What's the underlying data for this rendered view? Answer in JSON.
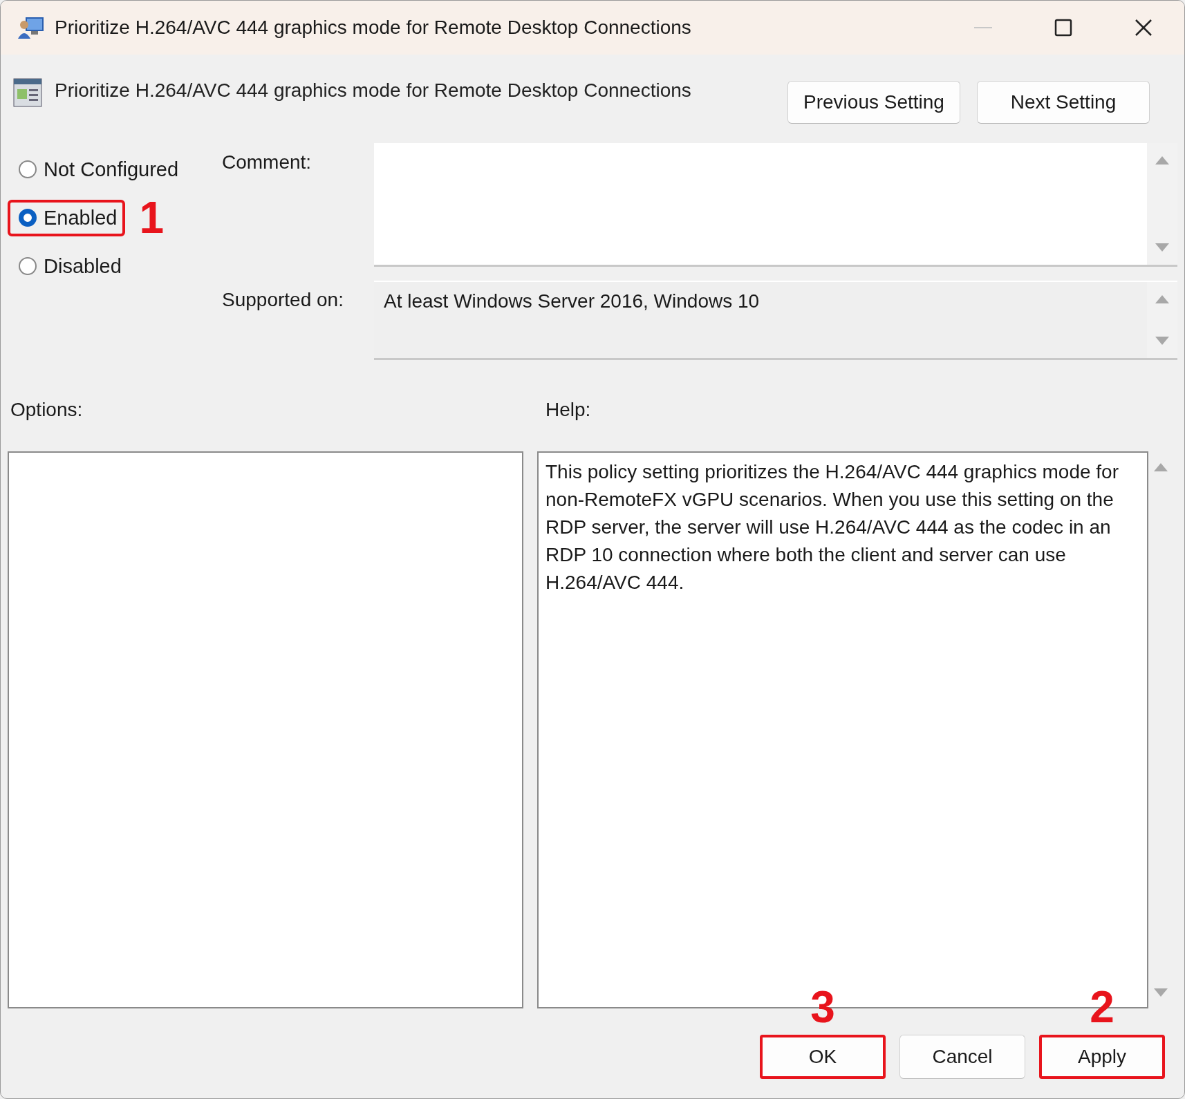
{
  "window": {
    "title": "Prioritize H.264/AVC 444 graphics mode for Remote Desktop Connections"
  },
  "header": {
    "title": "Prioritize H.264/AVC 444 graphics mode for Remote Desktop Connections",
    "buttons": [
      "Previous Setting",
      "Next Setting"
    ]
  },
  "state_options": [
    {
      "label": "Not Configured",
      "selected": false
    },
    {
      "label": "Enabled",
      "selected": true,
      "callout": "1"
    },
    {
      "label": "Disabled",
      "selected": false
    }
  ],
  "comment": {
    "label": "Comment:"
  },
  "supported_on": {
    "label": "Supported on:",
    "value": "At least Windows Server 2016, Windows 10"
  },
  "options": {
    "label": "Options:"
  },
  "help": {
    "label": "Help:",
    "text": "This policy setting prioritizes the H.264/AVC 444 graphics mode for non-RemoteFX vGPU scenarios. When you use this setting on the RDP server, the server will use H.264/AVC 444 as the codec in an RDP 10 connection where both the client and server can use H.264/AVC 444."
  },
  "footer_buttons": [
    {
      "label": "OK",
      "callout": "3"
    },
    {
      "label": "Cancel"
    },
    {
      "label": "Apply",
      "callout": "2"
    }
  ]
}
